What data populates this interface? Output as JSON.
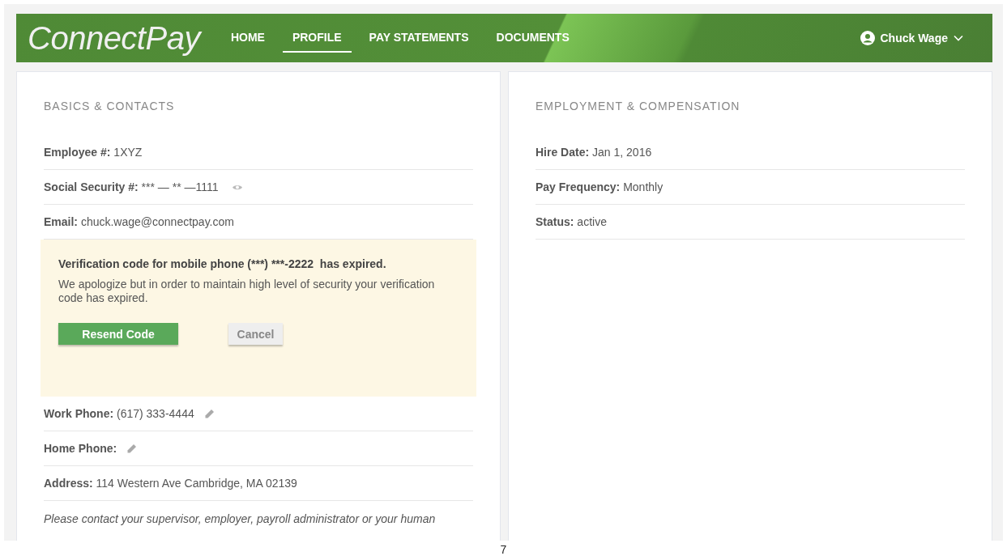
{
  "header": {
    "logo": "ConnectPay",
    "nav": [
      {
        "label": "HOME",
        "selected": false
      },
      {
        "label": "PROFILE",
        "selected": true
      },
      {
        "label": "PAY STATEMENTS",
        "selected": false
      },
      {
        "label": "DOCUMENTS",
        "selected": false
      }
    ],
    "user": "Chuck Wage"
  },
  "left_card": {
    "title": "BASICS & CONTACTS",
    "fields_before": [
      {
        "label": "Employee #:",
        "value": "1XYZ",
        "kind": "plain"
      },
      {
        "label": "Social Security #:",
        "value": "*** — ** —1111",
        "kind": "masked"
      },
      {
        "label": "Email:",
        "value": "chuck.wage@connectpay.com",
        "kind": "plain"
      }
    ],
    "alert": {
      "title": "Verification code for mobile phone (***) ***-2222  has expired.",
      "message": "We apologize but in order to maintain high level of security your verification code has expired.",
      "primary_button": "Resend Code",
      "secondary_button": "Cancel"
    },
    "fields_after": [
      {
        "label": "Work Phone:",
        "value": "(617) 333-4444",
        "kind": "editable"
      },
      {
        "label": "Home Phone:",
        "kind": "editable"
      },
      {
        "label": "Address:",
        "value": "114 Western Ave Cambridge, MA 02139",
        "kind": "plain"
      }
    ],
    "note": "Please contact your supervisor, employer, payroll administrator or your human"
  },
  "right_card": {
    "title": "EMPLOYMENT & COMPENSATION",
    "fields": [
      {
        "label": "Hire Date:",
        "value": "Jan 1, 2016",
        "kind": "plain"
      },
      {
        "label": "Pay Frequency:",
        "value": "Monthly",
        "kind": "plain"
      },
      {
        "label": "Status:",
        "value": "active",
        "kind": "plain"
      }
    ]
  },
  "page_number": "7"
}
